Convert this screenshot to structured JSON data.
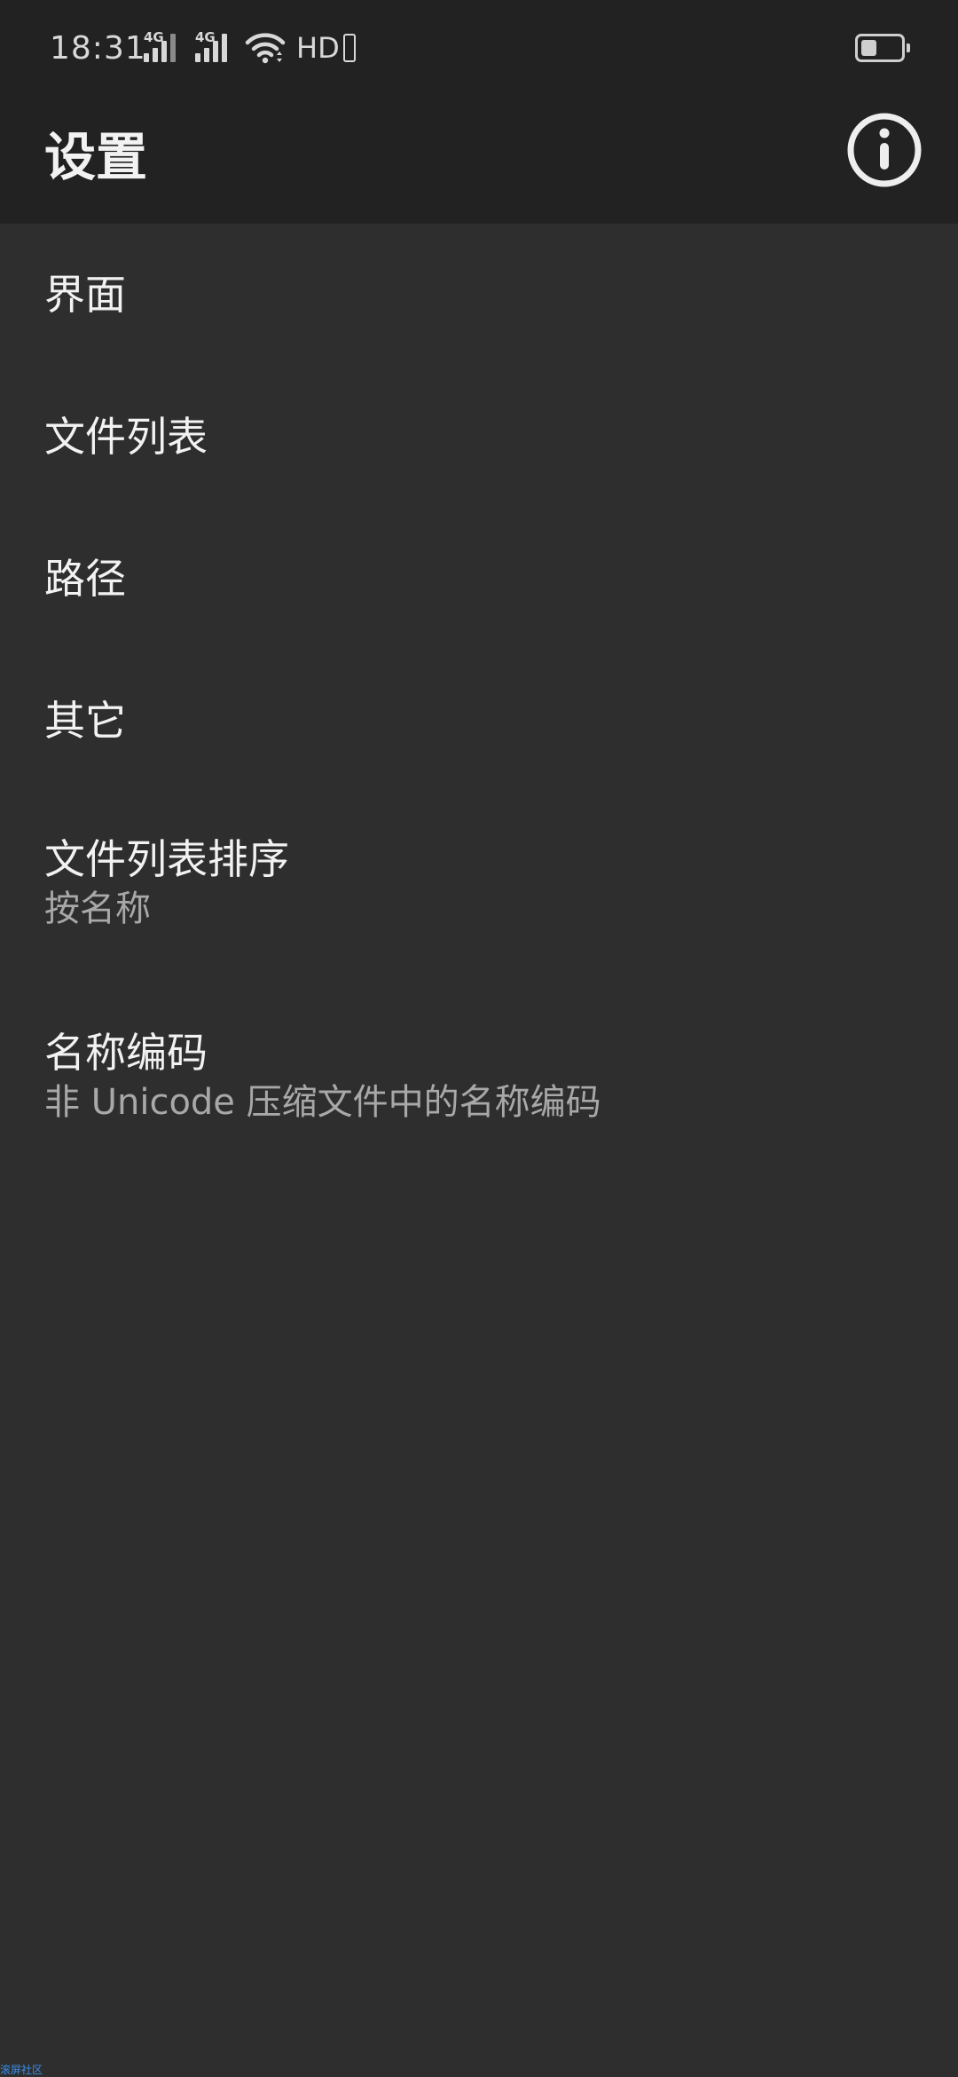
{
  "status_bar": {
    "time": "18:31",
    "signal_1_label": "4G",
    "signal_2_label": "4G",
    "hd_label": "HD",
    "battery_level": 0.4,
    "icons": [
      "signal-icon",
      "signal-icon",
      "wifi-icon",
      "hd-icon",
      "battery-icon"
    ]
  },
  "app_bar": {
    "title": "设置",
    "action_icon": "info-icon"
  },
  "settings": {
    "items": [
      {
        "title": "界面"
      },
      {
        "title": "文件列表"
      },
      {
        "title": "路径"
      },
      {
        "title": "其它"
      },
      {
        "title": "文件列表排序",
        "summary": "按名称"
      },
      {
        "title": "名称编码",
        "summary": "非 Unicode 压缩文件中的名称编码"
      }
    ]
  },
  "watermark": "滚屏社区",
  "colors": {
    "header_bg": "#222222",
    "content_bg": "#2e2e2e",
    "title_text": "#f2f2f2",
    "summary_text": "#a8a8a8",
    "watermark_text": "#3a8ee8"
  }
}
